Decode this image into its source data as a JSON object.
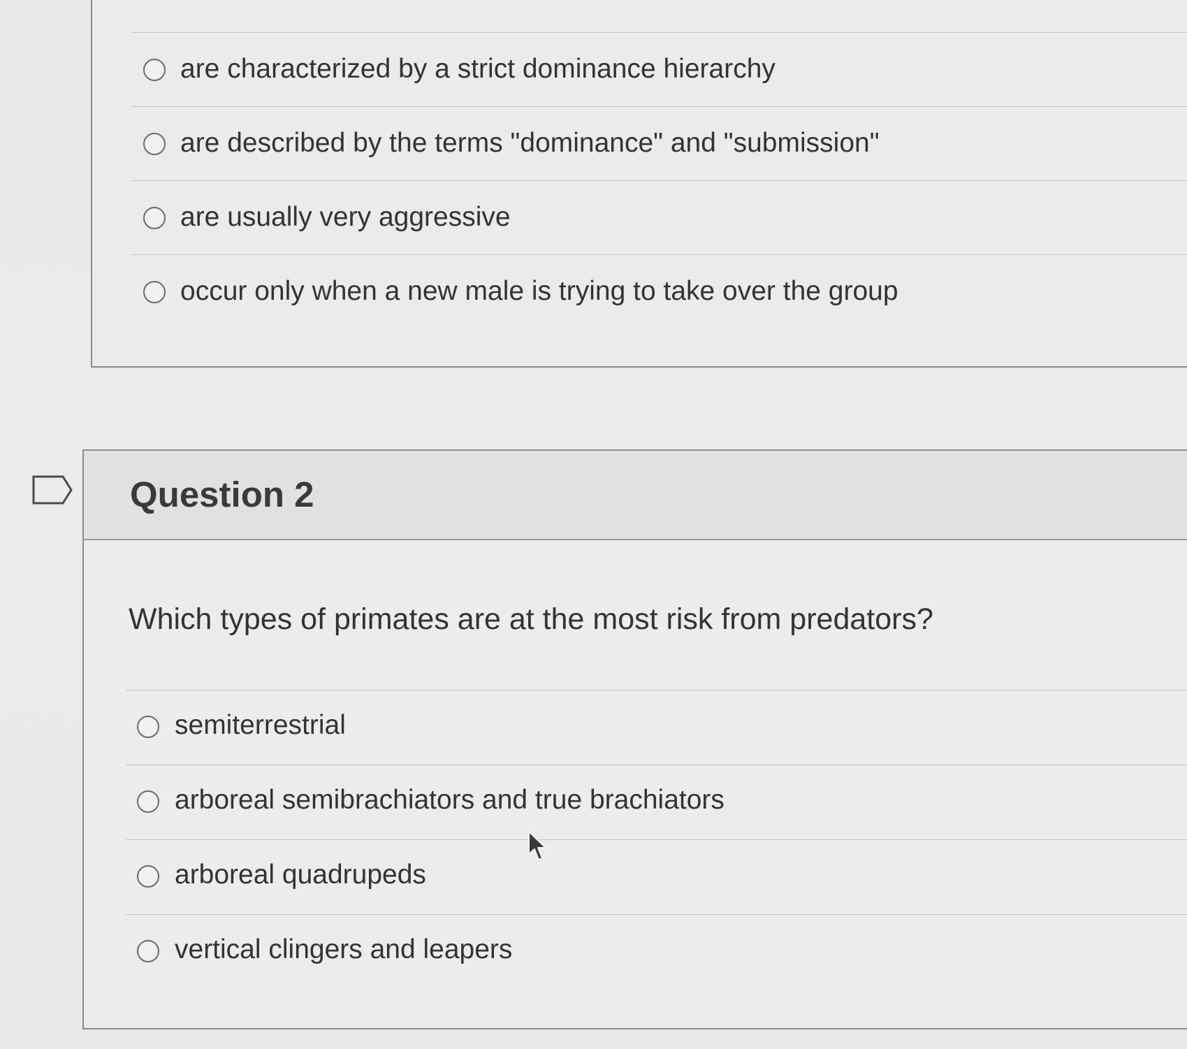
{
  "question1": {
    "options": [
      {
        "label": "are characterized by a strict dominance hierarchy"
      },
      {
        "label": "are described by the terms \"dominance\" and \"submission\""
      },
      {
        "label": "are usually very aggressive"
      },
      {
        "label": "occur only when a new male is trying to take over the group"
      }
    ]
  },
  "question2": {
    "title": "Question 2",
    "flag_icon": "flag-outline-icon",
    "prompt": "Which types of primates are at the most risk from predators?",
    "options": [
      {
        "label": "semiterrestrial"
      },
      {
        "label": "arboreal semibrachiators and true brachiators"
      },
      {
        "label": "arboreal quadrupeds"
      },
      {
        "label": "vertical clingers and leapers"
      }
    ]
  },
  "cursor_icon": "arrow-pointer-icon"
}
